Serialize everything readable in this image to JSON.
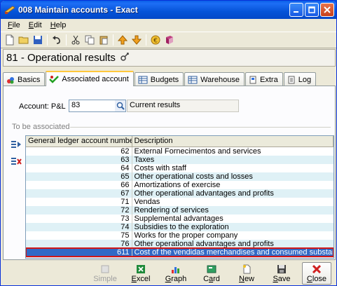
{
  "window": {
    "title": "008 Maintain accounts - Exact"
  },
  "menu": [
    {
      "label_pre": "",
      "label_key": "F",
      "label_post": "ile"
    },
    {
      "label_pre": "",
      "label_key": "E",
      "label_post": "dit"
    },
    {
      "label_pre": "",
      "label_key": "H",
      "label_post": "elp"
    }
  ],
  "heading": {
    "title": "81 - Operational results"
  },
  "tabs": [
    {
      "label": "Basics",
      "icon": "basics-icon",
      "active": false
    },
    {
      "label": "Associated account",
      "icon": "associated-account-icon",
      "active": true
    },
    {
      "label": "Budgets",
      "icon": "budgets-icon",
      "active": false
    },
    {
      "label": "Warehouse",
      "icon": "warehouse-icon",
      "active": false
    },
    {
      "label": "Extra",
      "icon": "extra-icon",
      "active": false
    },
    {
      "label": "Log",
      "icon": "log-icon",
      "active": false
    }
  ],
  "account": {
    "label": "Account: P&L",
    "value": "83",
    "description": "Current results"
  },
  "group": {
    "label": "To be associated"
  },
  "grid": {
    "columns": [
      "General ledger account number",
      "Description"
    ],
    "rows": [
      {
        "number": "62",
        "description": "External Fornecimentos and services"
      },
      {
        "number": "63",
        "description": "Taxes"
      },
      {
        "number": "64",
        "description": "Costs with staff"
      },
      {
        "number": "65",
        "description": "Other operational costs and losses"
      },
      {
        "number": "66",
        "description": "Amortizations of exercise"
      },
      {
        "number": "67",
        "description": "Other operational advantages and profits"
      },
      {
        "number": "71",
        "description": "Vendas"
      },
      {
        "number": "72",
        "description": "Rendering of services"
      },
      {
        "number": "73",
        "description": "Supplemental advantages"
      },
      {
        "number": "74",
        "description": "Subsidies to the exploration"
      },
      {
        "number": "75",
        "description": "Works for the proper company"
      },
      {
        "number": "76",
        "description": "Other operational advantages and profits"
      },
      {
        "number": "611",
        "description": "Cost of the vendidas merchandises and consumed substances",
        "selected": true
      }
    ]
  },
  "buttons": [
    {
      "name": "simple",
      "label": "Simple",
      "disabled": true
    },
    {
      "name": "excel",
      "label": "Excel"
    },
    {
      "name": "graph",
      "label": "Graph"
    },
    {
      "name": "card",
      "label": "Card"
    },
    {
      "name": "new",
      "label": "New"
    },
    {
      "name": "save",
      "label": "Save"
    },
    {
      "name": "close",
      "label": "Close"
    }
  ],
  "colors": {
    "titlebar": "#0553d8",
    "alt_row": "#dff1f6",
    "selection": "#3169c6",
    "selection_outline": "#d01818",
    "tab_accent": "#ffc83c"
  }
}
